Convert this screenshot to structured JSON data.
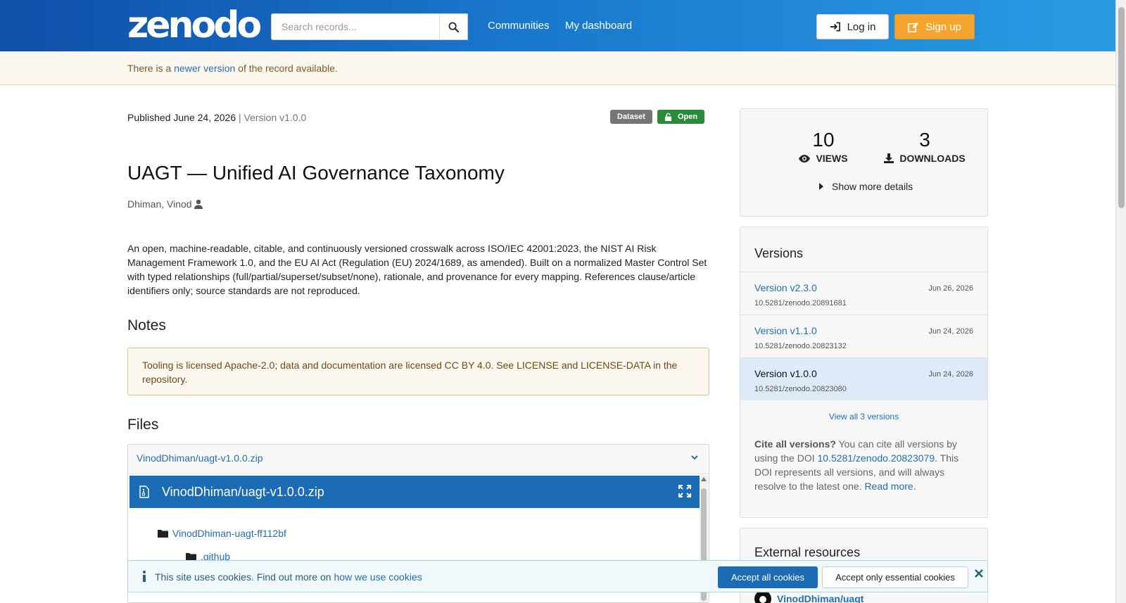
{
  "header": {
    "logo": "zenodo",
    "search_placeholder": "Search records...",
    "nav": [
      "Communities",
      "My dashboard"
    ],
    "login_label": "Log in",
    "signup_label": "Sign up"
  },
  "notice": {
    "prefix": "There is a ",
    "link": "newer version",
    "suffix": " of the record available."
  },
  "record": {
    "published": "Published June 24, 2026",
    "version_sep": " | ",
    "version": "Version v1.0.0",
    "badge_type": "Dataset",
    "badge_access": "Open",
    "title": "UAGT — Unified AI Governance Taxonomy",
    "author": "Dhiman, Vinod",
    "description": "An open, machine-readable, citable, and continuously versioned crosswalk across ISO/IEC 42001:2023, the NIST AI Risk Management Framework 1.0, and the EU AI Act (Regulation (EU) 2024/1689, as amended). Built on a normalized Master Control Set with typed relationships (full/partial/superset/subset/none), rationale, and provenance for every mapping. References clause/article identifiers only; source standards are not reproduced.",
    "notes_heading": "Notes",
    "notes_text": "Tooling is licensed Apache-2.0; data and documentation are licensed CC BY 4.0. See LICENSE and LICENSE-DATA in the repository.",
    "files_heading": "Files",
    "file_name": "VinodDhiman/uagt-v1.0.0.zip",
    "tree": [
      "VinodDhiman-uagt-ff112bf",
      ".github"
    ]
  },
  "stats": {
    "views": "10",
    "views_label": "VIEWS",
    "downloads": "3",
    "downloads_label": "DOWNLOADS",
    "show_more": "Show more details"
  },
  "versions": {
    "heading": "Versions",
    "items": [
      {
        "name": "Version v2.3.0",
        "date": "Jun 26, 2026",
        "doi": "10.5281/zenodo.20891681"
      },
      {
        "name": "Version v1.1.0",
        "date": "Jun 24, 2026",
        "doi": "10.5281/zenodo.20823132"
      },
      {
        "name": "Version v1.0.0",
        "date": "Jun 24, 2026",
        "doi": "10.5281/zenodo.20823080"
      }
    ],
    "view_all": "View all 3 versions",
    "cite_bold": "Cite all versions?",
    "cite_text1": " You can cite all versions by using the DOI ",
    "cite_doi": "10.5281/zenodo.20823079",
    "cite_text2": ". This DOI represents all versions, and will always resolve to the latest one. ",
    "cite_read_more": "Read more",
    "cite_end": "."
  },
  "external": {
    "heading": "External resources",
    "link": "VinodDhiman/uagt"
  },
  "cookie": {
    "text": "This site uses cookies. Find out more on ",
    "link": "how we use cookies",
    "accept_all": "Accept all cookies",
    "accept_essential": "Accept only essential cookies"
  },
  "colors": {
    "header_start": "#0f4fa8",
    "header_end": "#2a9be3",
    "signup": "#f4a52f",
    "link": "#1f6fb2",
    "open_badge": "#2c8a3c",
    "preview_bar": "#1b6bb5"
  }
}
